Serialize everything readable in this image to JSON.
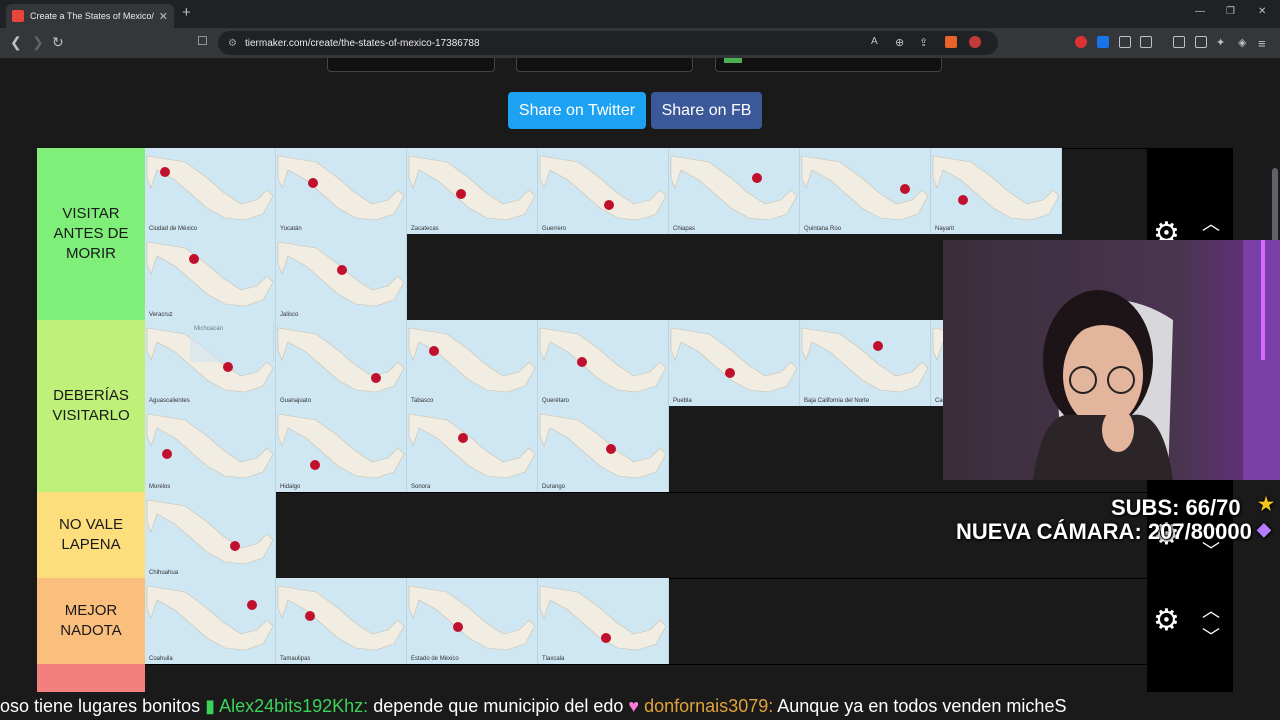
{
  "browser": {
    "tab_title": "Create a The States of Mexico/ Los",
    "url": "tiermaker.com/create/the-states-of-mexico-17386788"
  },
  "share": {
    "twitter": "Share on Twitter",
    "fb": "Share on FB"
  },
  "tiers": [
    {
      "label": "VISITAR\nANTES DE\nMORIR",
      "color": "#7fef7a",
      "items": [
        "Ciudad de México",
        "Yucatán",
        "Zacatecas",
        "Guerrero",
        "Chiapas",
        "Quintana Roo",
        "Nayarit",
        "Veracruz",
        "Jalisco"
      ]
    },
    {
      "label": "DEBERÍAS\nVISITARLO",
      "color": "#bff07a",
      "items": [
        "Aguascalientes",
        "Guanajuato",
        "Tabasco",
        "Querétaro",
        "Puebla",
        "Baja California del Norte",
        "Campeche",
        "Morelos",
        "Hidalgo",
        "Sonora",
        "Durango"
      ]
    },
    {
      "label": "NO VALE\nLAPENA",
      "color": "#fdde7d",
      "items": [
        "Chihuahua"
      ]
    },
    {
      "label": "MEJOR\nNADOTA",
      "color": "#fbbf7d",
      "items": [
        "Coahuila",
        "Tamaulipas",
        "Estado de México",
        "Tlaxcala"
      ]
    },
    {
      "label": "",
      "color": "#f47f7f",
      "items": []
    }
  ],
  "hover_item": "Michoacán",
  "overlay": {
    "subs": "SUBS: 66/70",
    "camera": "NUEVA CÁMARA: 207/80000"
  },
  "ticker": {
    "pre": "oso tiene lugares bonitos",
    "user1": "Alex24bits192Khz:",
    "msg1": "depende que municipio del edo",
    "user2": "donfornais3079:",
    "msg2": "Aunque ya en todos venden micheS"
  },
  "colors": {
    "region": "#c0102e",
    "map_bg": "#cfe6f3",
    "land": "#f1ede2"
  }
}
